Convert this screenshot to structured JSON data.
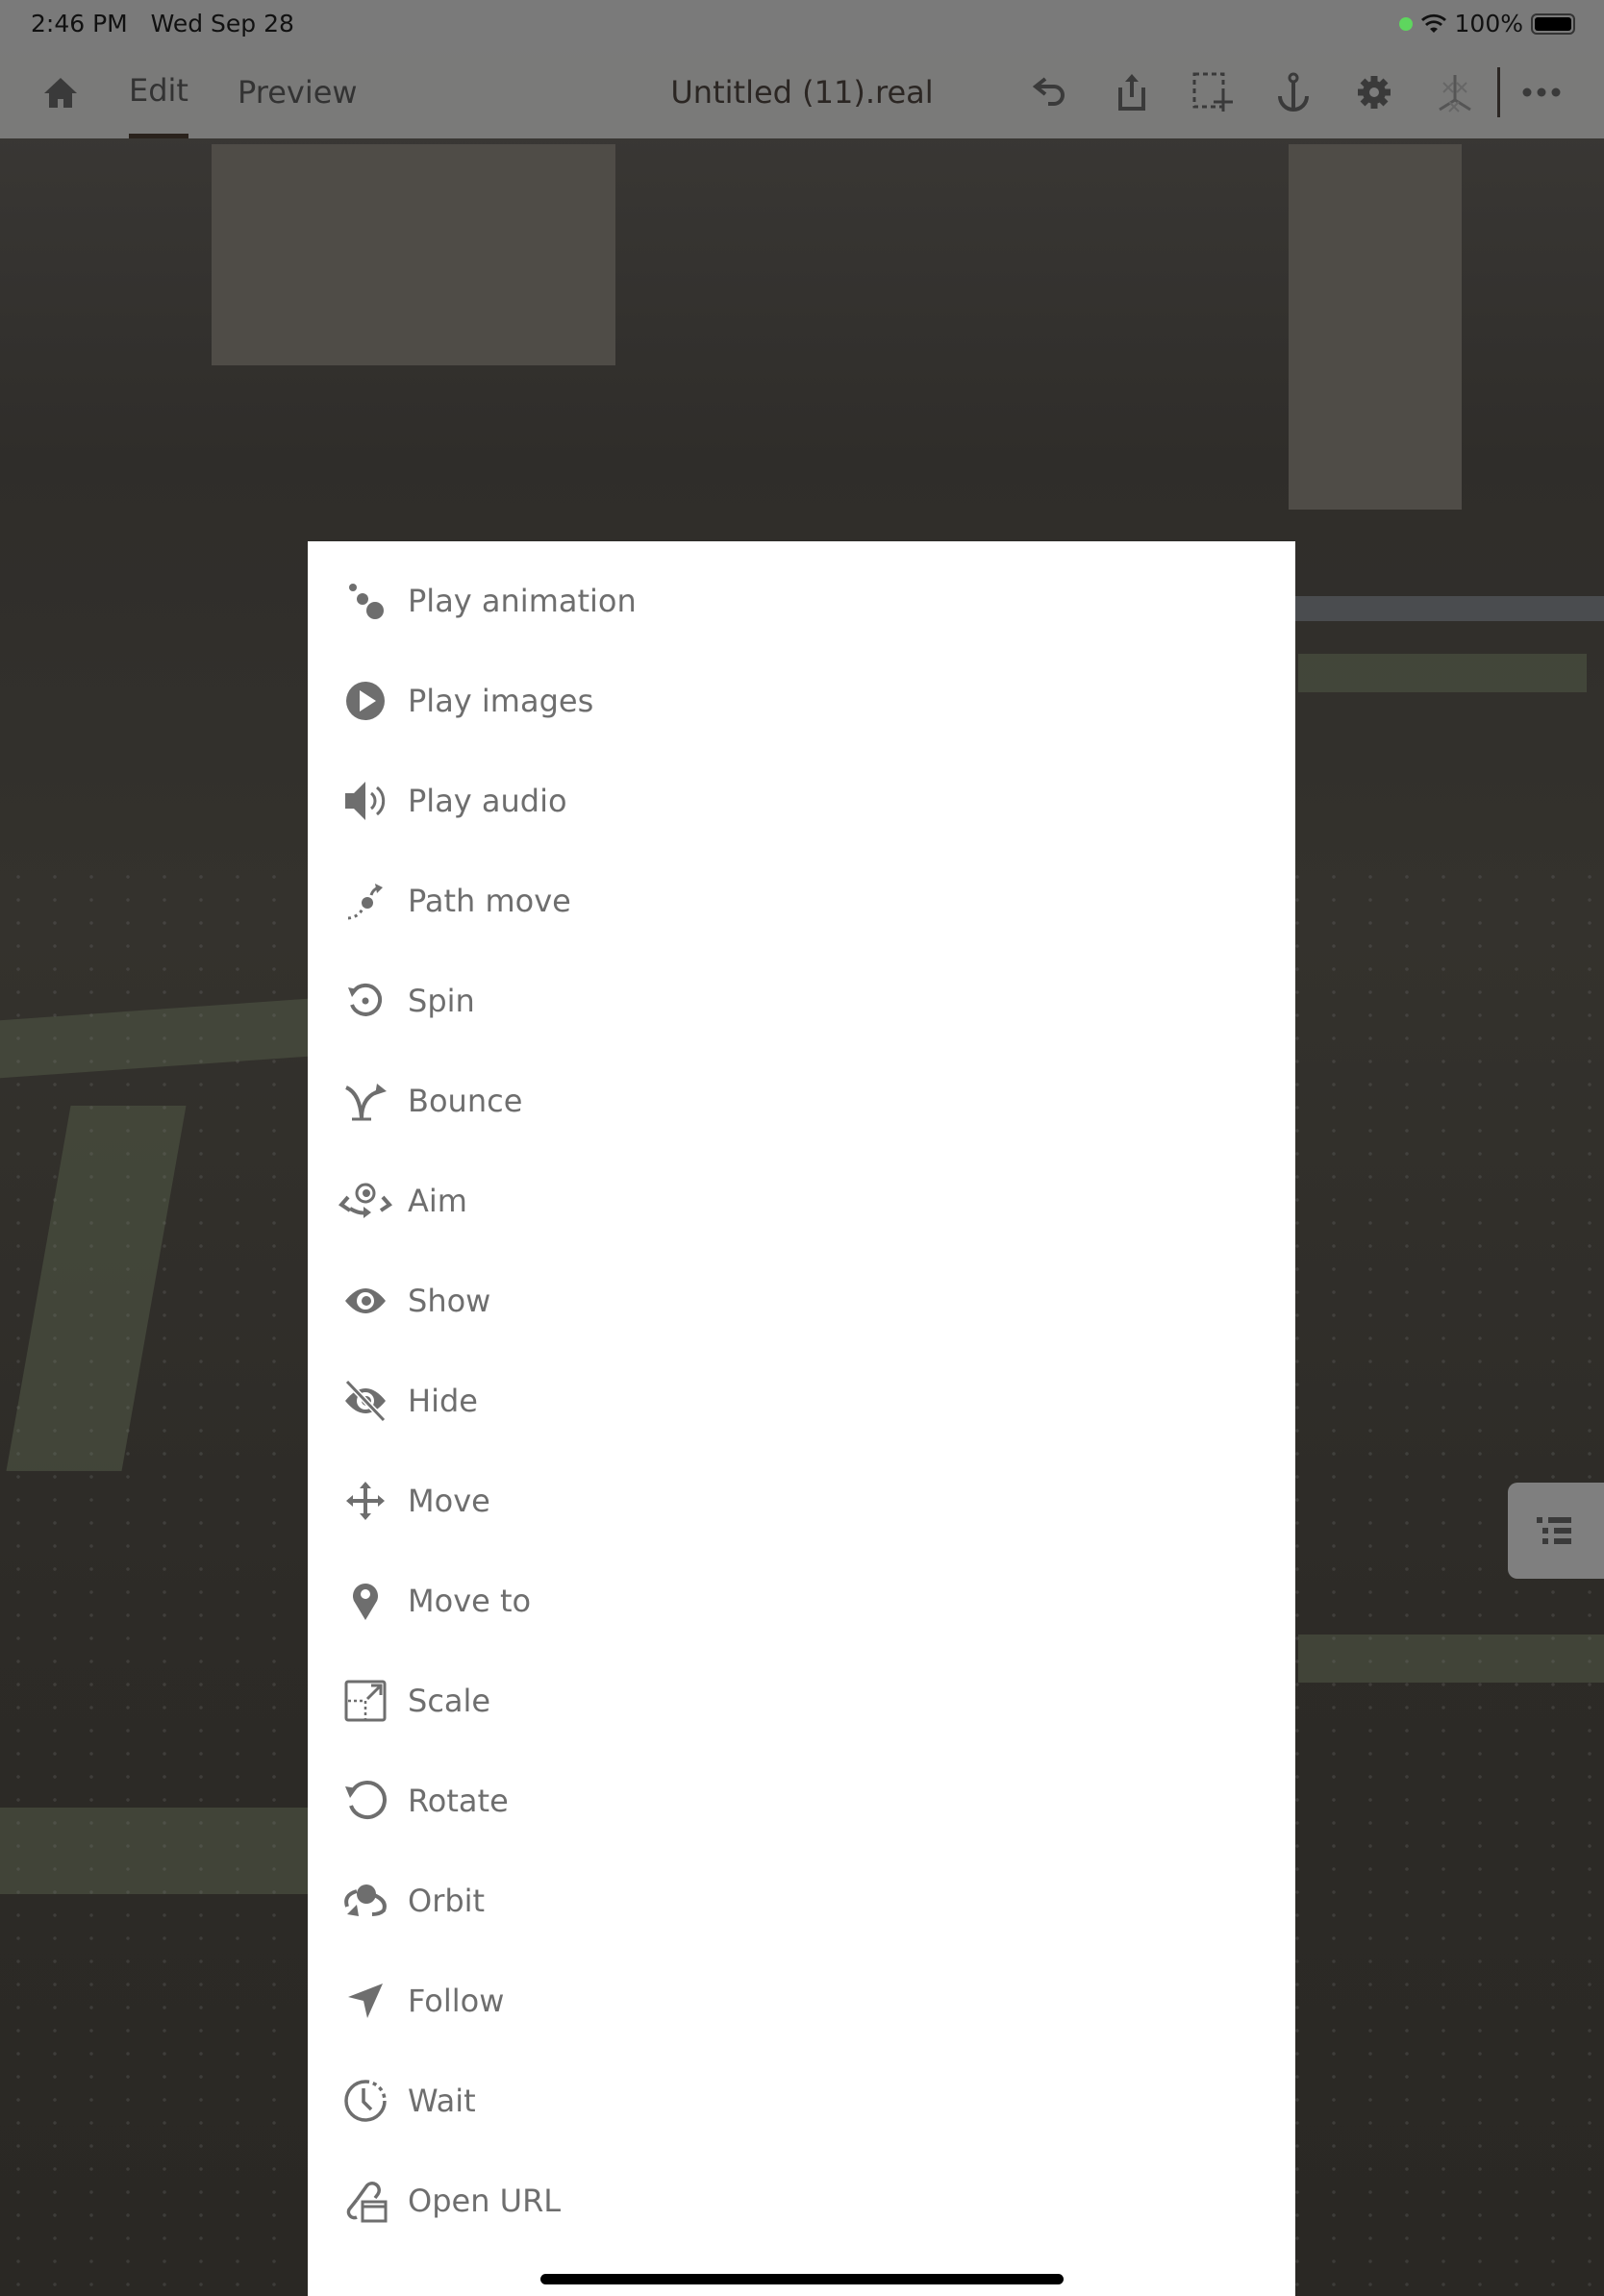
{
  "status_bar": {
    "time": "2:46 PM",
    "date": "Wed Sep 28",
    "battery": "100%",
    "icons": [
      "camera-in-use-dot",
      "wifi-icon",
      "battery-icon"
    ]
  },
  "toolbar": {
    "home_icon": "home-icon",
    "tabs": [
      {
        "label": "Edit",
        "active": true
      },
      {
        "label": "Preview",
        "active": false
      }
    ],
    "document_title": "Untitled (11).real",
    "actions": [
      "undo-icon",
      "share-icon",
      "select-move-icon",
      "anchor-icon",
      "settings-icon",
      "physics-icon",
      "more-icon"
    ]
  },
  "action_menu": {
    "items": [
      {
        "label": "Play animation",
        "icon": "play-animation-icon"
      },
      {
        "label": "Play images",
        "icon": "play-images-icon"
      },
      {
        "label": "Play audio",
        "icon": "speaker-icon"
      },
      {
        "label": "Path move",
        "icon": "path-move-icon"
      },
      {
        "label": "Spin",
        "icon": "spin-icon"
      },
      {
        "label": "Bounce",
        "icon": "bounce-icon"
      },
      {
        "label": "Aim",
        "icon": "aim-icon"
      },
      {
        "label": "Show",
        "icon": "eye-icon"
      },
      {
        "label": "Hide",
        "icon": "eye-off-icon"
      },
      {
        "label": "Move",
        "icon": "move-icon"
      },
      {
        "label": "Move to",
        "icon": "location-pin-icon"
      },
      {
        "label": "Scale",
        "icon": "scale-icon"
      },
      {
        "label": "Rotate",
        "icon": "rotate-icon"
      },
      {
        "label": "Orbit",
        "icon": "orbit-icon"
      },
      {
        "label": "Follow",
        "icon": "follow-arrow-icon"
      },
      {
        "label": "Wait",
        "icon": "clock-icon"
      },
      {
        "label": "Open URL",
        "icon": "open-url-icon"
      }
    ]
  },
  "side_panel_toggle": {
    "icon": "list-icon"
  },
  "colors": {
    "menu_bg": "#ffffff",
    "menu_text": "#6e6e6e",
    "toolbar_bg": "#7d7d7d",
    "toolbar_text": "#2b2623",
    "camera_dot": "#5ed65e"
  }
}
